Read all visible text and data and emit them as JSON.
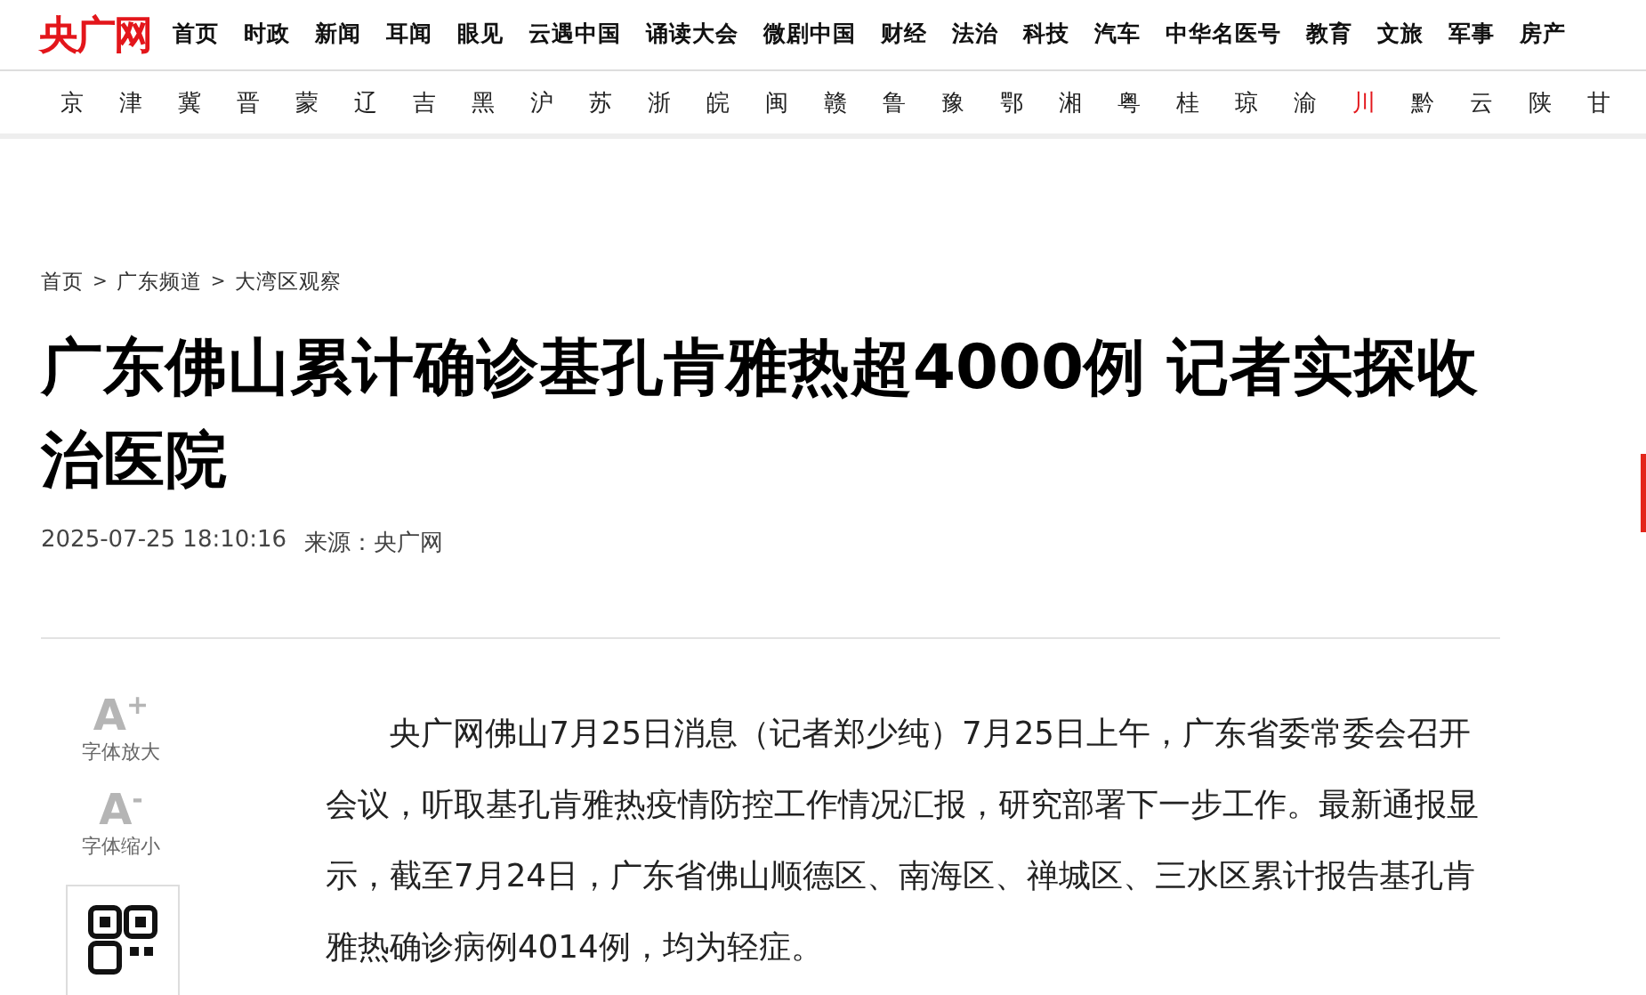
{
  "logo": "央广网",
  "nav": [
    "首页",
    "时政",
    "新闻",
    "耳闻",
    "眼见",
    "云遇中国",
    "诵读大会",
    "微剧中国",
    "财经",
    "法治",
    "科技",
    "汽车",
    "中华名医号",
    "教育",
    "文旅",
    "军事",
    "房产"
  ],
  "provinces": [
    {
      "label": "京",
      "selected": false
    },
    {
      "label": "津",
      "selected": false
    },
    {
      "label": "冀",
      "selected": false
    },
    {
      "label": "晋",
      "selected": false
    },
    {
      "label": "蒙",
      "selected": false
    },
    {
      "label": "辽",
      "selected": false
    },
    {
      "label": "吉",
      "selected": false
    },
    {
      "label": "黑",
      "selected": false
    },
    {
      "label": "沪",
      "selected": false
    },
    {
      "label": "苏",
      "selected": false
    },
    {
      "label": "浙",
      "selected": false
    },
    {
      "label": "皖",
      "selected": false
    },
    {
      "label": "闽",
      "selected": false
    },
    {
      "label": "赣",
      "selected": false
    },
    {
      "label": "鲁",
      "selected": false
    },
    {
      "label": "豫",
      "selected": false
    },
    {
      "label": "鄂",
      "selected": false
    },
    {
      "label": "湘",
      "selected": false
    },
    {
      "label": "粤",
      "selected": false
    },
    {
      "label": "桂",
      "selected": false
    },
    {
      "label": "琼",
      "selected": false
    },
    {
      "label": "渝",
      "selected": false
    },
    {
      "label": "川",
      "selected": true
    },
    {
      "label": "黔",
      "selected": false
    },
    {
      "label": "云",
      "selected": false
    },
    {
      "label": "陕",
      "selected": false
    },
    {
      "label": "甘",
      "selected": false
    }
  ],
  "breadcrumb": {
    "items": [
      "首页",
      "广东频道",
      "大湾区观察"
    ],
    "separator": ">"
  },
  "title": "广东佛山累计确诊基孔肯雅热超4000例 记者实探收治医院",
  "date": "2025-07-25 18:10:16",
  "source": "来源：央广网",
  "tools": [
    {
      "glyph": "A",
      "sign": "+",
      "label": "字体放大"
    },
    {
      "glyph": "A",
      "sign": "-",
      "label": "字体缩小"
    }
  ],
  "paragraphs": [
    "央广网佛山7月25日消息（记者郑少纯）7月25日上午，广东省委常委会召开会议，听取基孔肯雅热疫情防控工作情况汇报，研究部署下一步工作。最新通报显示，截至7月24日，广东省佛山顺德区、南海区、禅城区、三水区累计报告基孔肯雅热确诊病例4014例，均为轻症。"
  ]
}
